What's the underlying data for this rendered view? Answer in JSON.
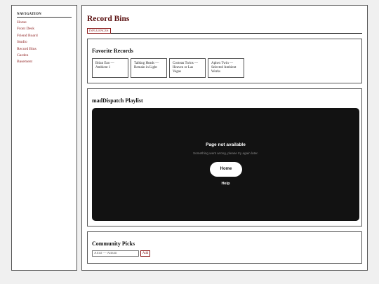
{
  "sidebar": {
    "title": "NAVIGATION",
    "items": [
      {
        "label": "Home"
      },
      {
        "label": "Front Desk"
      },
      {
        "label": "Friend Board"
      },
      {
        "label": "Studio"
      },
      {
        "label": "Record Bins"
      },
      {
        "label": "Garden"
      },
      {
        "label": "Basement"
      }
    ]
  },
  "page": {
    "title": "Record Bins",
    "tag": "INFLUENCES"
  },
  "favorites": {
    "title": "Favorite Records",
    "records": [
      {
        "label": "Brian Eno — Ambient 1"
      },
      {
        "label": "Talking Heads — Remain in Light"
      },
      {
        "label": "Cocteau Twins — Heaven or Las Vegas"
      },
      {
        "label": "Aphex Twin — Selected Ambient Works"
      }
    ]
  },
  "playlist": {
    "title": "madDispatch Playlist",
    "player": {
      "heading": "Page not available",
      "message": "Something went wrong, please try again later.",
      "home_label": "Home",
      "help_label": "Help"
    }
  },
  "community": {
    "title": "Community Picks",
    "input_placeholder": "Artist — Album",
    "add_label": "Add"
  },
  "colors": {
    "accent": "#8b1a1a",
    "title": "#5a0f0f",
    "player_bg": "#121212"
  }
}
